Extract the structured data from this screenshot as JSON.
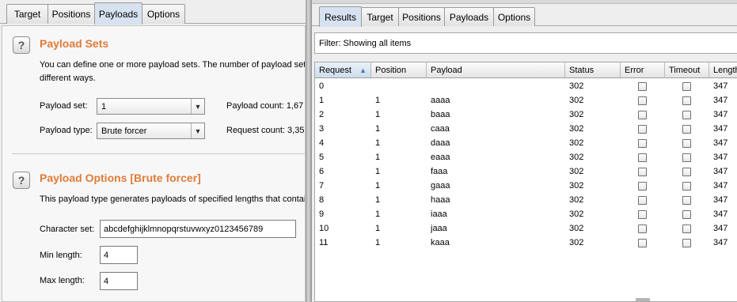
{
  "intruder": {
    "tabs": [
      "Target",
      "Positions",
      "Payloads",
      "Options"
    ],
    "active_tab": "Payloads",
    "payload_sets": {
      "title": "Payload Sets",
      "description_line1": "You can define one or more payload sets. The number of payload set",
      "description_line2": "different ways.",
      "payload_set_label": "Payload set:",
      "payload_set_value": "1",
      "payload_type_label": "Payload type:",
      "payload_type_value": "Brute forcer",
      "payload_count_label": "Payload count:  1,67",
      "request_count_label": "Request count:  3,35"
    },
    "payload_options": {
      "title": "Payload Options [Brute forcer]",
      "description": "This payload type generates payloads of specified lengths that contai",
      "character_set_label": "Character set:",
      "character_set_value": "abcdefghijklmnopqrstuvwxyz0123456789",
      "min_length_label": "Min length:",
      "min_length_value": "4",
      "max_length_label": "Max length:",
      "max_length_value": "4"
    },
    "help_glyph": "?"
  },
  "results_window": {
    "tabs": [
      "Results",
      "Target",
      "Positions",
      "Payloads",
      "Options"
    ],
    "active_tab": "Results",
    "filter_text": "Filter:  Showing all items",
    "columns": [
      "Request",
      "Position",
      "Payload",
      "Status",
      "Error",
      "Timeout",
      "Length"
    ],
    "sorted_column": "Request",
    "sort_icon": "sort-ascending-icon",
    "rows": [
      {
        "request": "0",
        "position": "",
        "payload": "",
        "status": "302",
        "error": false,
        "timeout": false,
        "length": "347"
      },
      {
        "request": "1",
        "position": "1",
        "payload": "aaaa",
        "status": "302",
        "error": false,
        "timeout": false,
        "length": "347"
      },
      {
        "request": "2",
        "position": "1",
        "payload": "baaa",
        "status": "302",
        "error": false,
        "timeout": false,
        "length": "347"
      },
      {
        "request": "3",
        "position": "1",
        "payload": "caaa",
        "status": "302",
        "error": false,
        "timeout": false,
        "length": "347"
      },
      {
        "request": "4",
        "position": "1",
        "payload": "daaa",
        "status": "302",
        "error": false,
        "timeout": false,
        "length": "347"
      },
      {
        "request": "5",
        "position": "1",
        "payload": "eaaa",
        "status": "302",
        "error": false,
        "timeout": false,
        "length": "347"
      },
      {
        "request": "6",
        "position": "1",
        "payload": "faaa",
        "status": "302",
        "error": false,
        "timeout": false,
        "length": "347"
      },
      {
        "request": "7",
        "position": "1",
        "payload": "gaaa",
        "status": "302",
        "error": false,
        "timeout": false,
        "length": "347"
      },
      {
        "request": "8",
        "position": "1",
        "payload": "haaa",
        "status": "302",
        "error": false,
        "timeout": false,
        "length": "347"
      },
      {
        "request": "9",
        "position": "1",
        "payload": "iaaa",
        "status": "302",
        "error": false,
        "timeout": false,
        "length": "347"
      },
      {
        "request": "10",
        "position": "1",
        "payload": "jaaa",
        "status": "302",
        "error": false,
        "timeout": false,
        "length": "347"
      },
      {
        "request": "11",
        "position": "1",
        "payload": "kaaa",
        "status": "302",
        "error": false,
        "timeout": false,
        "length": "347"
      }
    ]
  }
}
